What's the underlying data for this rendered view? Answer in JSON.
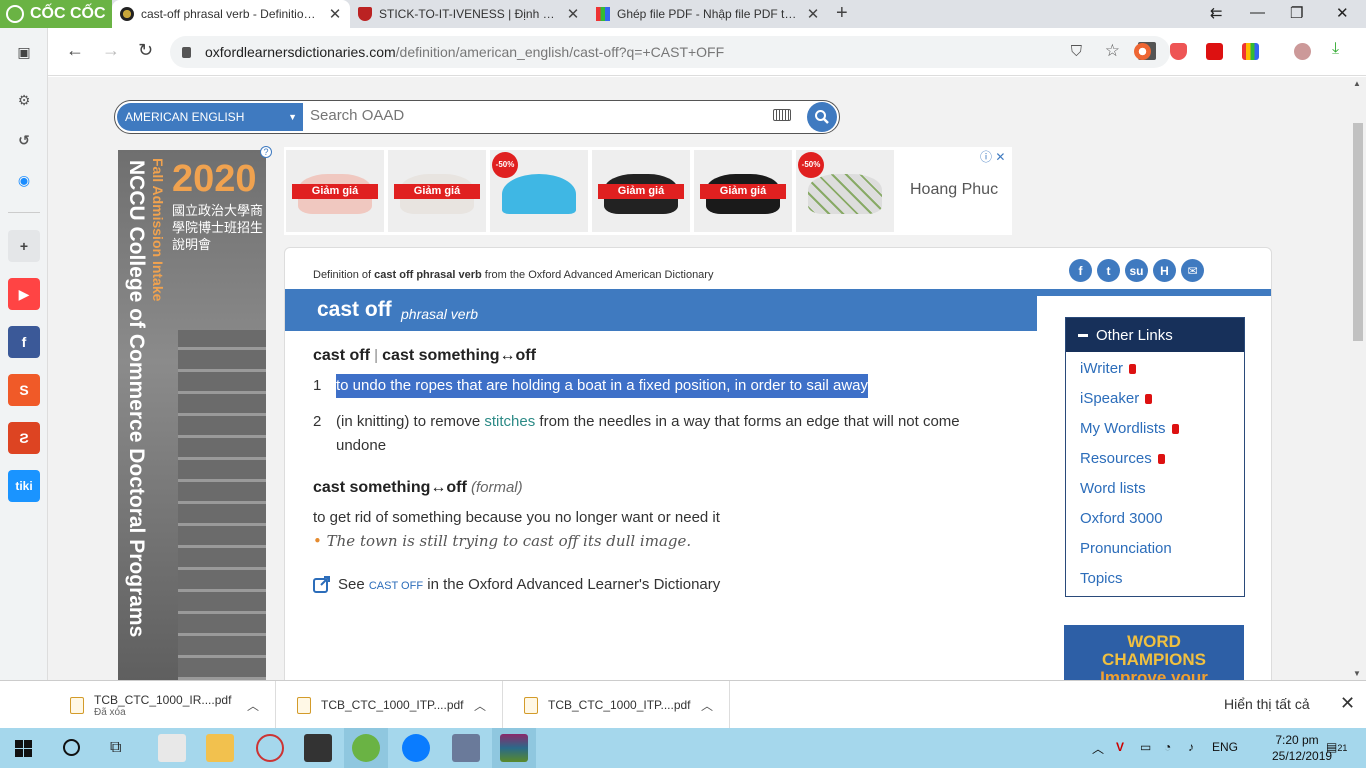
{
  "browser": {
    "brand": "CỐC CỐC",
    "tabs": [
      {
        "title": "cast-off phrasal verb - Definition, p"
      },
      {
        "title": "STICK-TO-IT-IVENESS | Định nghĩa"
      },
      {
        "title": "Ghép file PDF - Nhập file PDF trực"
      }
    ],
    "url_host": "oxfordlearnersdictionaries.com",
    "url_path": "/definition/american_english/cast-off?q=+CAST+OFF"
  },
  "search": {
    "dictionary": "AMERICAN ENGLISH",
    "placeholder": "Search OAAD"
  },
  "ads": {
    "left": {
      "year": "2020",
      "chinese": "國立政治大學商學院博士班招生說明會",
      "vertical_orange": "Fall Admission Intake",
      "vertical_white": "NCCU College of Commerce Doctoral Programs"
    },
    "top": {
      "sale_label": "Giảm giá",
      "discount": "-50%",
      "brand": "Hoang Phuc"
    }
  },
  "entry": {
    "definition_of_prefix": "Definition of ",
    "definition_of_word": "cast off phrasal verb",
    "definition_of_suffix": " from the Oxford Advanced American Dictionary",
    "headword": "cast off",
    "pos": "phrasal verb",
    "form1_a": "cast off",
    "form_sep": "|",
    "form1_b": "cast something↔off",
    "sense1_num": "1",
    "sense1_text": "to undo the ropes that are holding a boat in a fixed position, in order to sail away",
    "sense2_num": "2",
    "sense2_pre": "(in knitting) to remove ",
    "sense2_link": "stitches",
    "sense2_post": " from the needles in a way that forms an edge that will not come undone",
    "form2": "cast something↔off",
    "form2_register": "(formal)",
    "form2_def": "to get rid of something because you no longer want or need it",
    "example_bullet": "•",
    "example": "The town is still trying to cast off its dull image.",
    "see_prefix": "See ",
    "see_link": "cast off",
    "see_suffix": " in the Oxford Advanced Learner's Dictionary"
  },
  "other_links": {
    "title": "Other Links",
    "items": [
      {
        "label": "iWriter"
      },
      {
        "label": "iSpeaker"
      },
      {
        "label": "My Wordlists"
      },
      {
        "label": "Resources"
      },
      {
        "label": "Word lists"
      },
      {
        "label": "Oxford 3000"
      },
      {
        "label": "Pronunciation"
      },
      {
        "label": "Topics"
      }
    ]
  },
  "promo": {
    "line1": "WORD",
    "line2": "CHAMPIONS",
    "line3": "Improve your"
  },
  "downloads": {
    "items": [
      {
        "name": "TCB_CTC_1000_IR....pdf",
        "sub": "Đã xóa"
      },
      {
        "name": "TCB_CTC_1000_ITP....pdf"
      },
      {
        "name": "TCB_CTC_1000_ITP....pdf"
      }
    ],
    "show_all": "Hiển thị tất cả"
  },
  "taskbar": {
    "lang": "ENG",
    "time": "7:20 pm",
    "date": "25/12/2019",
    "notif_count": "21"
  },
  "colors": {
    "oxford_blue": "#3f7ac0",
    "other_links_header": "#17305a",
    "selection": "#3e70c8",
    "coccoc_green": "#6ab344",
    "sale_red": "#e02020"
  }
}
